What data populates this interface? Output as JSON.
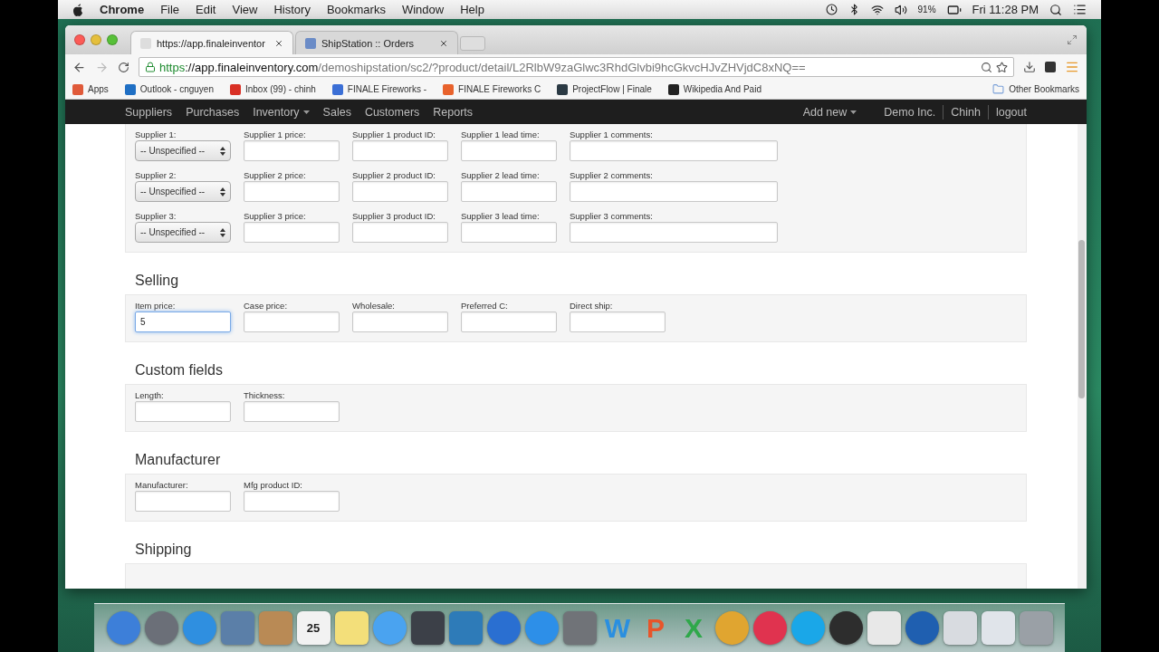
{
  "menubar": {
    "app": "Chrome",
    "menus": [
      "File",
      "Edit",
      "View",
      "History",
      "Bookmarks",
      "Window",
      "Help"
    ],
    "battery": "91%",
    "clock": "Fri 11:28 PM"
  },
  "browser": {
    "tabs": [
      {
        "title": "https://app.finaleinventor",
        "selected": true
      },
      {
        "title": "ShipStation :: Orders",
        "selected": false
      }
    ],
    "url": {
      "scheme": "https",
      "host": "://app.finaleinventory.com",
      "path": "/demoshipstation/sc2/?product/detail/L2RlbW9zaGlwc3RhdGlvbi9hcGkvcHJvZHVjdC8xNQ=="
    },
    "bookmarks": {
      "apps": "Apps",
      "items": [
        {
          "title": "Outlook - cnguyen",
          "color": "#1f6fc4"
        },
        {
          "title": "Inbox (99) - chinh",
          "color": "#d93025"
        },
        {
          "title": "FINALE Fireworks -",
          "color": "#3b6fd6"
        },
        {
          "title": "FINALE Fireworks C",
          "color": "#e8622c"
        },
        {
          "title": "ProjectFlow | Finale",
          "color": "#2b3a44"
        },
        {
          "title": "Wikipedia And Paid",
          "color": "#222222"
        }
      ],
      "other": "Other Bookmarks"
    }
  },
  "app_nav": {
    "left": [
      {
        "label": "Suppliers",
        "dropdown": false
      },
      {
        "label": "Purchases",
        "dropdown": false
      },
      {
        "label": "Inventory",
        "dropdown": true
      },
      {
        "label": "Sales",
        "dropdown": false
      },
      {
        "label": "Customers",
        "dropdown": false
      },
      {
        "label": "Reports",
        "dropdown": false
      }
    ],
    "add_new": "Add new",
    "right": [
      "Demo Inc.",
      "Chinh",
      "logout"
    ]
  },
  "sections": [
    {
      "rows": [
        [
          {
            "kind": "select",
            "label": "Supplier 1:",
            "value": "-- Unspecified --"
          },
          {
            "kind": "input",
            "label": "Supplier 1 price:"
          },
          {
            "kind": "input",
            "label": "Supplier 1 product ID:"
          },
          {
            "kind": "input",
            "label": "Supplier 1 lead time:"
          },
          {
            "kind": "wide",
            "label": "Supplier 1 comments:"
          }
        ],
        [
          {
            "kind": "select",
            "label": "Supplier 2:",
            "value": "-- Unspecified --"
          },
          {
            "kind": "input",
            "label": "Supplier 2 price:"
          },
          {
            "kind": "input",
            "label": "Supplier 2 product ID:"
          },
          {
            "kind": "input",
            "label": "Supplier 2 lead time:"
          },
          {
            "kind": "wide",
            "label": "Supplier 2 comments:"
          }
        ],
        [
          {
            "kind": "select",
            "label": "Supplier 3:",
            "value": "-- Unspecified --"
          },
          {
            "kind": "input",
            "label": "Supplier 3 price:"
          },
          {
            "kind": "input",
            "label": "Supplier 3 product ID:"
          },
          {
            "kind": "input",
            "label": "Supplier 3 lead time:"
          },
          {
            "kind": "wide",
            "label": "Supplier 3 comments:"
          }
        ]
      ]
    },
    {
      "title": "Selling",
      "rows": [
        [
          {
            "kind": "input",
            "label": "Item price:",
            "value": "5",
            "focused": true
          },
          {
            "kind": "input",
            "label": "Case price:",
            "focused": false
          },
          {
            "kind": "input",
            "label": "Wholesale:",
            "focused": false
          },
          {
            "kind": "input",
            "label": "Preferred C:",
            "focused": false
          },
          {
            "kind": "input",
            "label": "Direct ship:",
            "focused": false
          }
        ]
      ]
    },
    {
      "title": "Custom fields",
      "rows": [
        [
          {
            "kind": "input",
            "label": "Length:"
          },
          {
            "kind": "input",
            "label": "Thickness:"
          }
        ]
      ]
    },
    {
      "title": "Manufacturer",
      "rows": [
        [
          {
            "kind": "input",
            "label": "Manufacturer:"
          },
          {
            "kind": "input",
            "label": "Mfg product ID:"
          }
        ]
      ]
    },
    {
      "title": "Shipping"
    }
  ],
  "dock": [
    {
      "kind": "round",
      "color": "#3d7fd9"
    },
    {
      "kind": "round",
      "color": "#6b6f78"
    },
    {
      "kind": "round",
      "color": "#2f8fe0"
    },
    {
      "kind": "square",
      "color": "#5b7fa8"
    },
    {
      "kind": "square",
      "color": "#b98a55"
    },
    {
      "kind": "square",
      "color": "#f2f2f2",
      "text": "25"
    },
    {
      "kind": "square",
      "color": "#f3df7a"
    },
    {
      "kind": "round",
      "color": "#4aa3f0"
    },
    {
      "kind": "square",
      "color": "#3c4048"
    },
    {
      "kind": "square",
      "color": "#2e7bb8"
    },
    {
      "kind": "round",
      "color": "#2a6fd1"
    },
    {
      "kind": "round",
      "color": "#2d8fe8"
    },
    {
      "kind": "square",
      "color": "#707378"
    },
    {
      "kind": "letter",
      "color": "#2a8fe0",
      "text": "W"
    },
    {
      "kind": "letter",
      "color": "#e8552a",
      "text": "P"
    },
    {
      "kind": "letter",
      "color": "#2fa84a",
      "text": "X"
    },
    {
      "kind": "round",
      "color": "#e0a530"
    },
    {
      "kind": "round",
      "color": "#e0334f"
    },
    {
      "kind": "round",
      "color": "#1aa7e8"
    },
    {
      "kind": "round",
      "color": "#2d2d2d"
    },
    {
      "kind": "square",
      "color": "#e8e8e8"
    },
    {
      "kind": "round",
      "color": "#1f5fb0"
    },
    {
      "kind": "square",
      "color": "#d8dbe0"
    },
    {
      "kind": "square",
      "color": "#e0e4ea"
    },
    {
      "kind": "square",
      "color": "#9aa0a6"
    }
  ]
}
